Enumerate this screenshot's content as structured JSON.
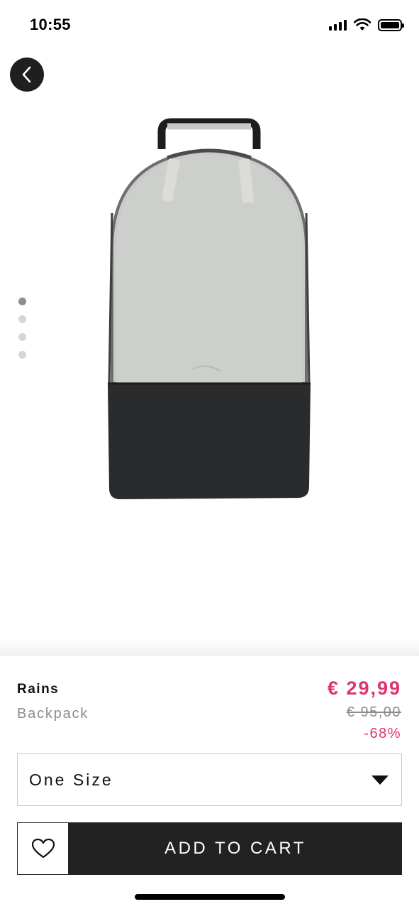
{
  "status_bar": {
    "time": "10:55"
  },
  "gallery": {
    "page_count": 4,
    "active_page": 1
  },
  "product": {
    "brand": "Rains",
    "name": "Backpack",
    "price_now": "€ 29,99",
    "price_old": "€ 95,00",
    "discount": "-68%"
  },
  "size_select": {
    "value": "One Size"
  },
  "actions": {
    "add_to_cart_label": "ADD TO CART"
  },
  "colors": {
    "accent": "#e0336a",
    "dark": "#222222",
    "muted": "#8c8c8c"
  },
  "icons": [
    "back-icon",
    "heart-icon",
    "chevron-down-icon",
    "signal-icon",
    "wifi-icon",
    "battery-icon"
  ]
}
